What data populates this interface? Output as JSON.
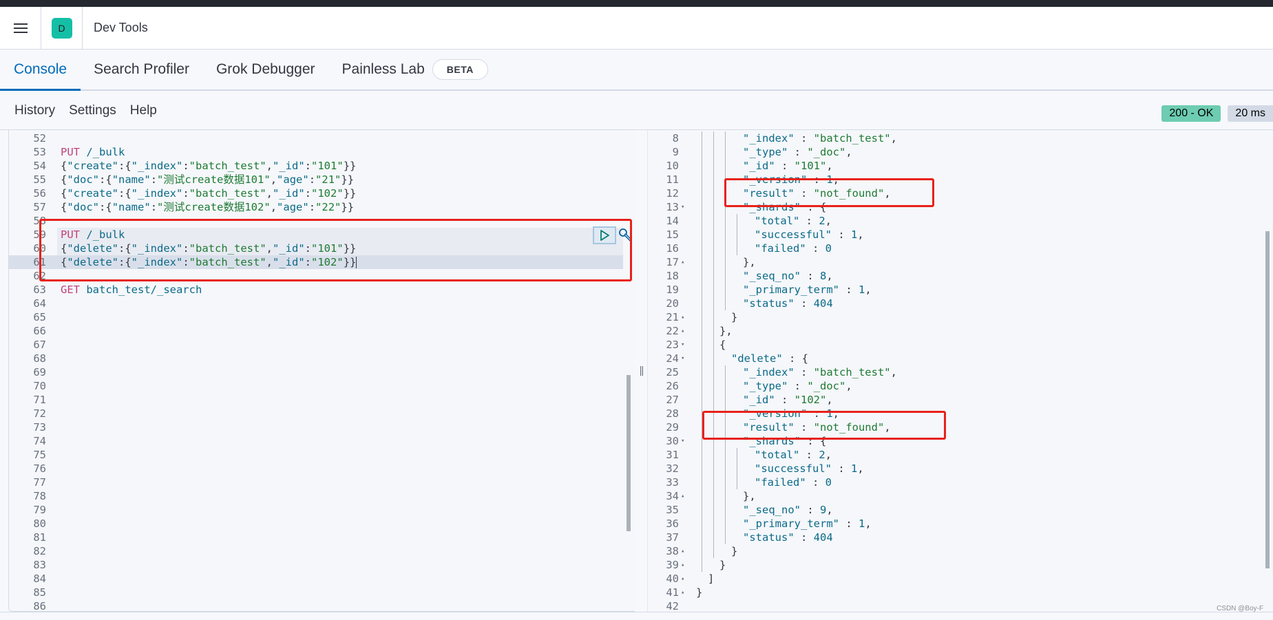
{
  "header": {
    "space_initial": "D",
    "app_title": "Dev Tools",
    "space_color": "#15bfa6"
  },
  "tabs": [
    {
      "label": "Console",
      "active": true
    },
    {
      "label": "Search Profiler",
      "active": false
    },
    {
      "label": "Grok Debugger",
      "active": false
    },
    {
      "label": "Painless Lab",
      "active": false,
      "badge": "BETA"
    }
  ],
  "toolbar": {
    "history": "History",
    "settings": "Settings",
    "help": "Help"
  },
  "status": {
    "code": "200 - OK",
    "time": "20 ms",
    "ok_color": "#6dccb1"
  },
  "editor": {
    "lines": [
      {
        "n": "52",
        "tokens": []
      },
      {
        "n": "53",
        "tokens": [
          {
            "t": "PUT",
            "c": "k-method"
          },
          {
            "t": " /_bulk",
            "c": "k-url"
          }
        ]
      },
      {
        "n": "54",
        "tokens": [
          {
            "t": "{",
            "c": "k-punct"
          },
          {
            "t": "\"create\"",
            "c": "k-key"
          },
          {
            "t": ":{",
            "c": "k-punct"
          },
          {
            "t": "\"_index\"",
            "c": "k-key"
          },
          {
            "t": ":",
            "c": "k-punct"
          },
          {
            "t": "\"batch_test\"",
            "c": "k-str"
          },
          {
            "t": ",",
            "c": "k-punct"
          },
          {
            "t": "\"_id\"",
            "c": "k-key"
          },
          {
            "t": ":",
            "c": "k-punct"
          },
          {
            "t": "\"101\"",
            "c": "k-str"
          },
          {
            "t": "}}",
            "c": "k-punct"
          }
        ]
      },
      {
        "n": "55",
        "tokens": [
          {
            "t": "{",
            "c": "k-punct"
          },
          {
            "t": "\"doc\"",
            "c": "k-key"
          },
          {
            "t": ":{",
            "c": "k-punct"
          },
          {
            "t": "\"name\"",
            "c": "k-key"
          },
          {
            "t": ":",
            "c": "k-punct"
          },
          {
            "t": "\"测试create数据101\"",
            "c": "k-str"
          },
          {
            "t": ",",
            "c": "k-punct"
          },
          {
            "t": "\"age\"",
            "c": "k-key"
          },
          {
            "t": ":",
            "c": "k-punct"
          },
          {
            "t": "\"21\"",
            "c": "k-str"
          },
          {
            "t": "}}",
            "c": "k-punct"
          }
        ]
      },
      {
        "n": "56",
        "tokens": [
          {
            "t": "{",
            "c": "k-punct"
          },
          {
            "t": "\"create\"",
            "c": "k-key"
          },
          {
            "t": ":{",
            "c": "k-punct"
          },
          {
            "t": "\"_index\"",
            "c": "k-key"
          },
          {
            "t": ":",
            "c": "k-punct"
          },
          {
            "t": "\"batch_test\"",
            "c": "k-str"
          },
          {
            "t": ",",
            "c": "k-punct"
          },
          {
            "t": "\"_id\"",
            "c": "k-key"
          },
          {
            "t": ":",
            "c": "k-punct"
          },
          {
            "t": "\"102\"",
            "c": "k-str"
          },
          {
            "t": "}}",
            "c": "k-punct"
          }
        ]
      },
      {
        "n": "57",
        "tokens": [
          {
            "t": "{",
            "c": "k-punct"
          },
          {
            "t": "\"doc\"",
            "c": "k-key"
          },
          {
            "t": ":{",
            "c": "k-punct"
          },
          {
            "t": "\"name\"",
            "c": "k-key"
          },
          {
            "t": ":",
            "c": "k-punct"
          },
          {
            "t": "\"测试create数据102\"",
            "c": "k-str"
          },
          {
            "t": ",",
            "c": "k-punct"
          },
          {
            "t": "\"age\"",
            "c": "k-key"
          },
          {
            "t": ":",
            "c": "k-punct"
          },
          {
            "t": "\"22\"",
            "c": "k-str"
          },
          {
            "t": "}}",
            "c": "k-punct"
          }
        ]
      },
      {
        "n": "58",
        "tokens": []
      },
      {
        "n": "59",
        "hl": "block",
        "tokens": [
          {
            "t": "PUT",
            "c": "k-method"
          },
          {
            "t": " /_bulk",
            "c": "k-url"
          }
        ]
      },
      {
        "n": "60",
        "hl": "block",
        "tokens": [
          {
            "t": "{",
            "c": "k-punct"
          },
          {
            "t": "\"delete\"",
            "c": "k-key"
          },
          {
            "t": ":{",
            "c": "k-punct"
          },
          {
            "t": "\"_index\"",
            "c": "k-key"
          },
          {
            "t": ":",
            "c": "k-punct"
          },
          {
            "t": "\"batch_test\"",
            "c": "k-str"
          },
          {
            "t": ",",
            "c": "k-punct"
          },
          {
            "t": "\"_id\"",
            "c": "k-key"
          },
          {
            "t": ":",
            "c": "k-punct"
          },
          {
            "t": "\"101\"",
            "c": "k-str"
          },
          {
            "t": "}}",
            "c": "k-punct"
          }
        ]
      },
      {
        "n": "61",
        "hl": "cur",
        "tokens": [
          {
            "t": "{",
            "c": "k-punct"
          },
          {
            "t": "\"delete\"",
            "c": "k-key"
          },
          {
            "t": ":{",
            "c": "k-punct"
          },
          {
            "t": "\"_index\"",
            "c": "k-key"
          },
          {
            "t": ":",
            "c": "k-punct"
          },
          {
            "t": "\"batch_test\"",
            "c": "k-str"
          },
          {
            "t": ",",
            "c": "k-punct"
          },
          {
            "t": "\"_id\"",
            "c": "k-key"
          },
          {
            "t": ":",
            "c": "k-punct"
          },
          {
            "t": "\"102\"",
            "c": "k-str"
          },
          {
            "t": "}}",
            "c": "k-punct"
          }
        ],
        "cursor": true
      },
      {
        "n": "62",
        "tokens": []
      },
      {
        "n": "63",
        "tokens": [
          {
            "t": "GET",
            "c": "k-method"
          },
          {
            "t": " batch_test/_search",
            "c": "k-url"
          }
        ]
      },
      {
        "n": "64",
        "tokens": []
      },
      {
        "n": "65",
        "tokens": []
      },
      {
        "n": "66",
        "tokens": []
      },
      {
        "n": "67",
        "tokens": []
      },
      {
        "n": "68",
        "tokens": []
      },
      {
        "n": "69",
        "tokens": []
      },
      {
        "n": "70",
        "tokens": []
      },
      {
        "n": "71",
        "tokens": []
      },
      {
        "n": "72",
        "tokens": []
      },
      {
        "n": "73",
        "tokens": []
      },
      {
        "n": "74",
        "tokens": []
      },
      {
        "n": "75",
        "tokens": []
      },
      {
        "n": "76",
        "tokens": []
      },
      {
        "n": "77",
        "tokens": []
      },
      {
        "n": "78",
        "tokens": []
      },
      {
        "n": "79",
        "tokens": []
      },
      {
        "n": "80",
        "tokens": []
      },
      {
        "n": "81",
        "tokens": []
      },
      {
        "n": "82",
        "tokens": []
      },
      {
        "n": "83",
        "tokens": []
      },
      {
        "n": "84",
        "tokens": []
      },
      {
        "n": "85",
        "tokens": []
      },
      {
        "n": "86",
        "tokens": []
      }
    ],
    "run_icon": "play-icon",
    "wrench_icon": "wrench-icon"
  },
  "output": {
    "lines": [
      {
        "n": "8",
        "indent": 4,
        "tokens": [
          {
            "t": "\"_index\"",
            "c": "k-key"
          },
          {
            "t": " : ",
            "c": "k-punct"
          },
          {
            "t": "\"batch_test\"",
            "c": "k-str"
          },
          {
            "t": ",",
            "c": "k-punct"
          }
        ]
      },
      {
        "n": "9",
        "indent": 4,
        "tokens": [
          {
            "t": "\"_type\"",
            "c": "k-key"
          },
          {
            "t": " : ",
            "c": "k-punct"
          },
          {
            "t": "\"_doc\"",
            "c": "k-str"
          },
          {
            "t": ",",
            "c": "k-punct"
          }
        ]
      },
      {
        "n": "10",
        "indent": 4,
        "tokens": [
          {
            "t": "\"_id\"",
            "c": "k-key"
          },
          {
            "t": " : ",
            "c": "k-punct"
          },
          {
            "t": "\"101\"",
            "c": "k-str"
          },
          {
            "t": ",",
            "c": "k-punct"
          }
        ]
      },
      {
        "n": "11",
        "indent": 4,
        "tokens": [
          {
            "t": "\"_version\"",
            "c": "k-key"
          },
          {
            "t": " : ",
            "c": "k-punct"
          },
          {
            "t": "1",
            "c": "k-num"
          },
          {
            "t": ",",
            "c": "k-punct"
          }
        ]
      },
      {
        "n": "12",
        "indent": 4,
        "tokens": [
          {
            "t": "\"result\"",
            "c": "k-key"
          },
          {
            "t": " : ",
            "c": "k-punct"
          },
          {
            "t": "\"not_found\"",
            "c": "k-str"
          },
          {
            "t": ",",
            "c": "k-punct"
          }
        ]
      },
      {
        "n": "13",
        "indent": 4,
        "fold": "▾",
        "tokens": [
          {
            "t": "\"_shards\"",
            "c": "k-key"
          },
          {
            "t": " : {",
            "c": "k-punct"
          }
        ]
      },
      {
        "n": "14",
        "indent": 5,
        "tokens": [
          {
            "t": "\"total\"",
            "c": "k-key"
          },
          {
            "t": " : ",
            "c": "k-punct"
          },
          {
            "t": "2",
            "c": "k-num"
          },
          {
            "t": ",",
            "c": "k-punct"
          }
        ]
      },
      {
        "n": "15",
        "indent": 5,
        "tokens": [
          {
            "t": "\"successful\"",
            "c": "k-key"
          },
          {
            "t": " : ",
            "c": "k-punct"
          },
          {
            "t": "1",
            "c": "k-num"
          },
          {
            "t": ",",
            "c": "k-punct"
          }
        ]
      },
      {
        "n": "16",
        "indent": 5,
        "tokens": [
          {
            "t": "\"failed\"",
            "c": "k-key"
          },
          {
            "t": " : ",
            "c": "k-punct"
          },
          {
            "t": "0",
            "c": "k-num"
          }
        ]
      },
      {
        "n": "17",
        "indent": 4,
        "fold": "▴",
        "tokens": [
          {
            "t": "},",
            "c": "k-punct"
          }
        ]
      },
      {
        "n": "18",
        "indent": 4,
        "tokens": [
          {
            "t": "\"_seq_no\"",
            "c": "k-key"
          },
          {
            "t": " : ",
            "c": "k-punct"
          },
          {
            "t": "8",
            "c": "k-num"
          },
          {
            "t": ",",
            "c": "k-punct"
          }
        ]
      },
      {
        "n": "19",
        "indent": 4,
        "tokens": [
          {
            "t": "\"_primary_term\"",
            "c": "k-key"
          },
          {
            "t": " : ",
            "c": "k-punct"
          },
          {
            "t": "1",
            "c": "k-num"
          },
          {
            "t": ",",
            "c": "k-punct"
          }
        ]
      },
      {
        "n": "20",
        "indent": 4,
        "tokens": [
          {
            "t": "\"status\"",
            "c": "k-key"
          },
          {
            "t": " : ",
            "c": "k-punct"
          },
          {
            "t": "404",
            "c": "k-num"
          }
        ]
      },
      {
        "n": "21",
        "indent": 3,
        "fold": "▴",
        "tokens": [
          {
            "t": "}",
            "c": "k-punct"
          }
        ]
      },
      {
        "n": "22",
        "indent": 2,
        "fold": "▴",
        "tokens": [
          {
            "t": "},",
            "c": "k-punct"
          }
        ]
      },
      {
        "n": "23",
        "indent": 2,
        "fold": "▾",
        "tokens": [
          {
            "t": "{",
            "c": "k-punct"
          }
        ]
      },
      {
        "n": "24",
        "indent": 3,
        "fold": "▾",
        "tokens": [
          {
            "t": "\"delete\"",
            "c": "k-key"
          },
          {
            "t": " : {",
            "c": "k-punct"
          }
        ]
      },
      {
        "n": "25",
        "indent": 4,
        "tokens": [
          {
            "t": "\"_index\"",
            "c": "k-key"
          },
          {
            "t": " : ",
            "c": "k-punct"
          },
          {
            "t": "\"batch_test\"",
            "c": "k-str"
          },
          {
            "t": ",",
            "c": "k-punct"
          }
        ]
      },
      {
        "n": "26",
        "indent": 4,
        "tokens": [
          {
            "t": "\"_type\"",
            "c": "k-key"
          },
          {
            "t": " : ",
            "c": "k-punct"
          },
          {
            "t": "\"_doc\"",
            "c": "k-str"
          },
          {
            "t": ",",
            "c": "k-punct"
          }
        ]
      },
      {
        "n": "27",
        "indent": 4,
        "tokens": [
          {
            "t": "\"_id\"",
            "c": "k-key"
          },
          {
            "t": " : ",
            "c": "k-punct"
          },
          {
            "t": "\"102\"",
            "c": "k-str"
          },
          {
            "t": ",",
            "c": "k-punct"
          }
        ]
      },
      {
        "n": "28",
        "indent": 4,
        "tokens": [
          {
            "t": "\"_version\"",
            "c": "k-key"
          },
          {
            "t": " : ",
            "c": "k-punct"
          },
          {
            "t": "1",
            "c": "k-num"
          },
          {
            "t": ",",
            "c": "k-punct"
          }
        ]
      },
      {
        "n": "29",
        "indent": 4,
        "tokens": [
          {
            "t": "\"result\"",
            "c": "k-key"
          },
          {
            "t": " : ",
            "c": "k-punct"
          },
          {
            "t": "\"not_found\"",
            "c": "k-str"
          },
          {
            "t": ",",
            "c": "k-punct"
          }
        ]
      },
      {
        "n": "30",
        "indent": 4,
        "fold": "▾",
        "tokens": [
          {
            "t": "\"_shards\"",
            "c": "k-key"
          },
          {
            "t": " : {",
            "c": "k-punct"
          }
        ]
      },
      {
        "n": "31",
        "indent": 5,
        "tokens": [
          {
            "t": "\"total\"",
            "c": "k-key"
          },
          {
            "t": " : ",
            "c": "k-punct"
          },
          {
            "t": "2",
            "c": "k-num"
          },
          {
            "t": ",",
            "c": "k-punct"
          }
        ]
      },
      {
        "n": "32",
        "indent": 5,
        "tokens": [
          {
            "t": "\"successful\"",
            "c": "k-key"
          },
          {
            "t": " : ",
            "c": "k-punct"
          },
          {
            "t": "1",
            "c": "k-num"
          },
          {
            "t": ",",
            "c": "k-punct"
          }
        ]
      },
      {
        "n": "33",
        "indent": 5,
        "tokens": [
          {
            "t": "\"failed\"",
            "c": "k-key"
          },
          {
            "t": " : ",
            "c": "k-punct"
          },
          {
            "t": "0",
            "c": "k-num"
          }
        ]
      },
      {
        "n": "34",
        "indent": 4,
        "fold": "▴",
        "tokens": [
          {
            "t": "},",
            "c": "k-punct"
          }
        ]
      },
      {
        "n": "35",
        "indent": 4,
        "tokens": [
          {
            "t": "\"_seq_no\"",
            "c": "k-key"
          },
          {
            "t": " : ",
            "c": "k-punct"
          },
          {
            "t": "9",
            "c": "k-num"
          },
          {
            "t": ",",
            "c": "k-punct"
          }
        ]
      },
      {
        "n": "36",
        "indent": 4,
        "tokens": [
          {
            "t": "\"_primary_term\"",
            "c": "k-key"
          },
          {
            "t": " : ",
            "c": "k-punct"
          },
          {
            "t": "1",
            "c": "k-num"
          },
          {
            "t": ",",
            "c": "k-punct"
          }
        ]
      },
      {
        "n": "37",
        "indent": 4,
        "tokens": [
          {
            "t": "\"status\"",
            "c": "k-key"
          },
          {
            "t": " : ",
            "c": "k-punct"
          },
          {
            "t": "404",
            "c": "k-num"
          }
        ]
      },
      {
        "n": "38",
        "indent": 3,
        "fold": "▴",
        "tokens": [
          {
            "t": "}",
            "c": "k-punct"
          }
        ]
      },
      {
        "n": "39",
        "indent": 2,
        "fold": "▴",
        "tokens": [
          {
            "t": "}",
            "c": "k-punct"
          }
        ]
      },
      {
        "n": "40",
        "indent": 1,
        "fold": "▴",
        "tokens": [
          {
            "t": "]",
            "c": "k-punct"
          }
        ]
      },
      {
        "n": "41",
        "indent": 0,
        "fold": "▴",
        "tokens": [
          {
            "t": "}",
            "c": "k-punct"
          }
        ]
      },
      {
        "n": "42",
        "indent": 0,
        "tokens": []
      }
    ]
  },
  "annotations": {
    "highlight_color": "#e8211b"
  },
  "watermark": "CSDN @Boy-F"
}
